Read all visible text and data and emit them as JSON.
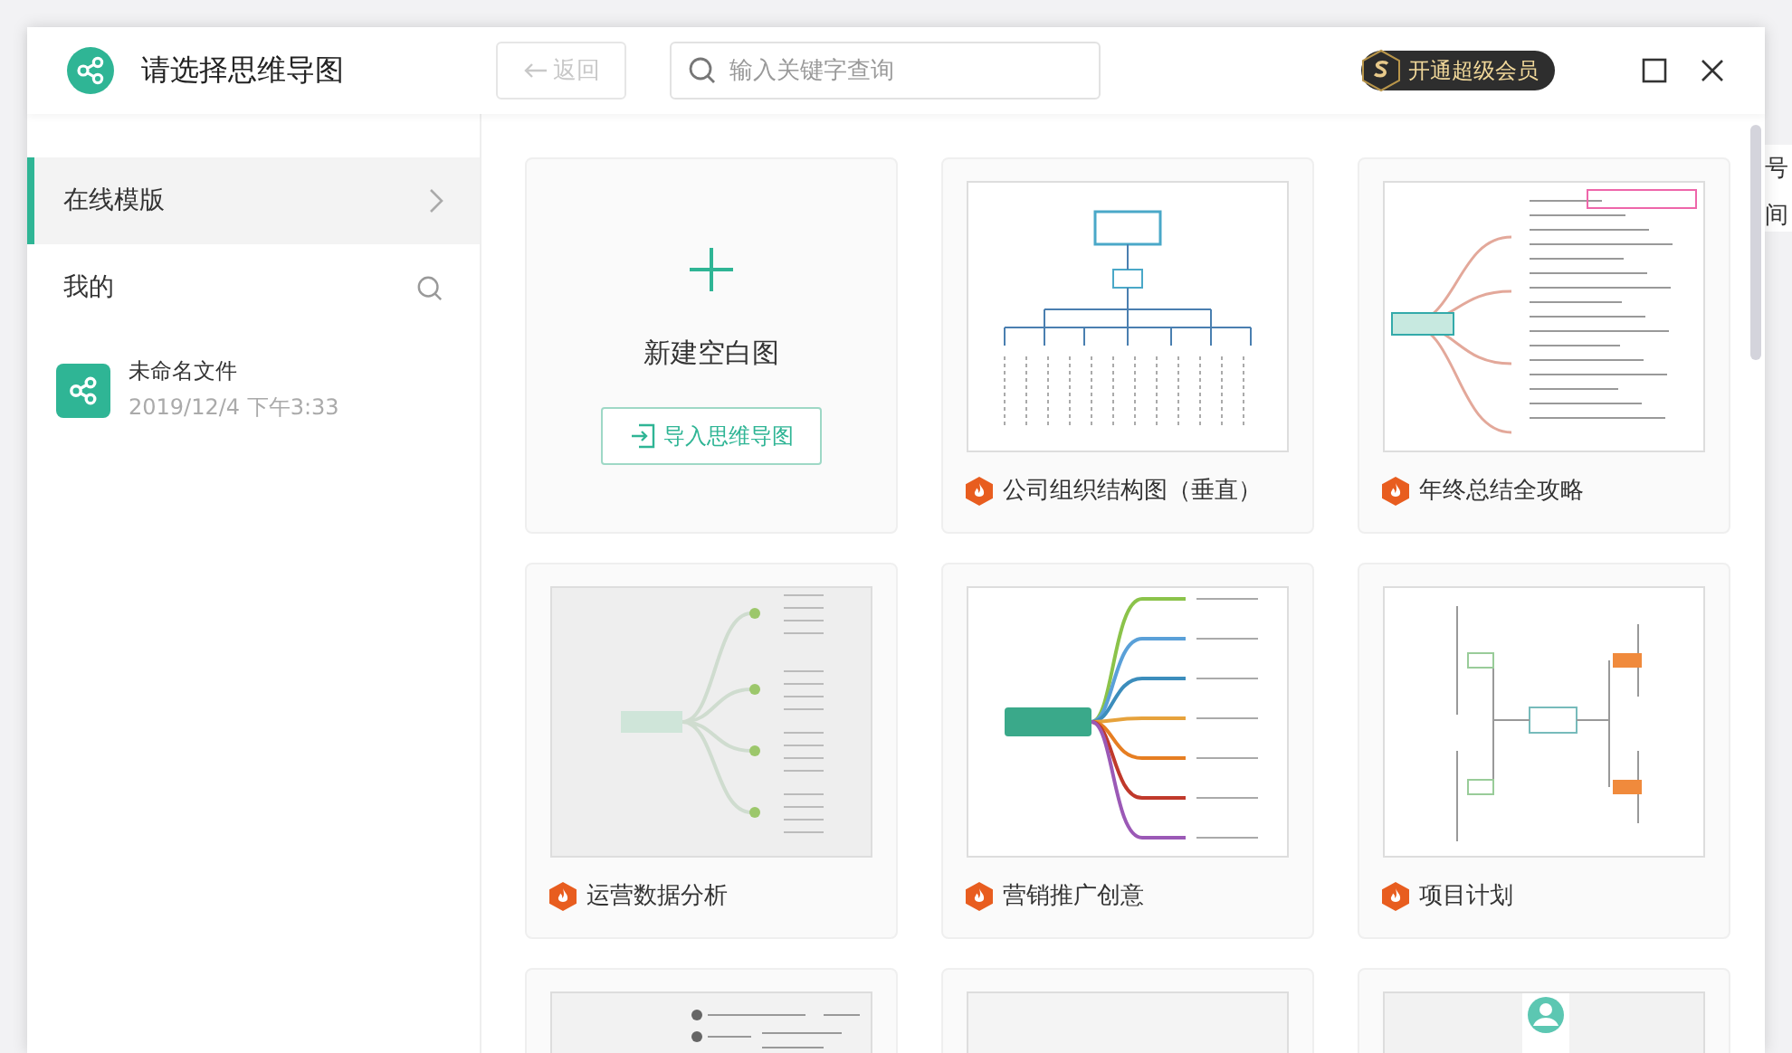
{
  "background": {
    "fragments": [
      "号",
      "间"
    ]
  },
  "window": {
    "title": "请选择思维导图",
    "back_button": {
      "label": "返回",
      "disabled": true
    },
    "search": {
      "placeholder": "输入关键字查询"
    },
    "vip_badge": "开通超级会员"
  },
  "sidebar": {
    "sections": [
      {
        "label": "在线模版",
        "selected": true,
        "kind": "nav"
      },
      {
        "label": "我的",
        "selected": false,
        "kind": "search"
      }
    ],
    "files": [
      {
        "name": "未命名文件",
        "time": "2019/12/4 下午3:33"
      }
    ]
  },
  "new_card": {
    "title": "新建空白图",
    "button": "导入思维导图"
  },
  "templates": [
    {
      "title": "公司组织结构图（垂直）",
      "kind": "org"
    },
    {
      "title": "年终总结全攻略",
      "kind": "summary"
    },
    {
      "title": "运营数据分析",
      "kind": "mindgrey"
    },
    {
      "title": "营销推广创意",
      "kind": "mindcolor"
    },
    {
      "title": "项目计划",
      "kind": "logic"
    },
    {
      "kind": "list"
    },
    {
      "kind": "blank"
    },
    {
      "kind": "profile"
    }
  ]
}
